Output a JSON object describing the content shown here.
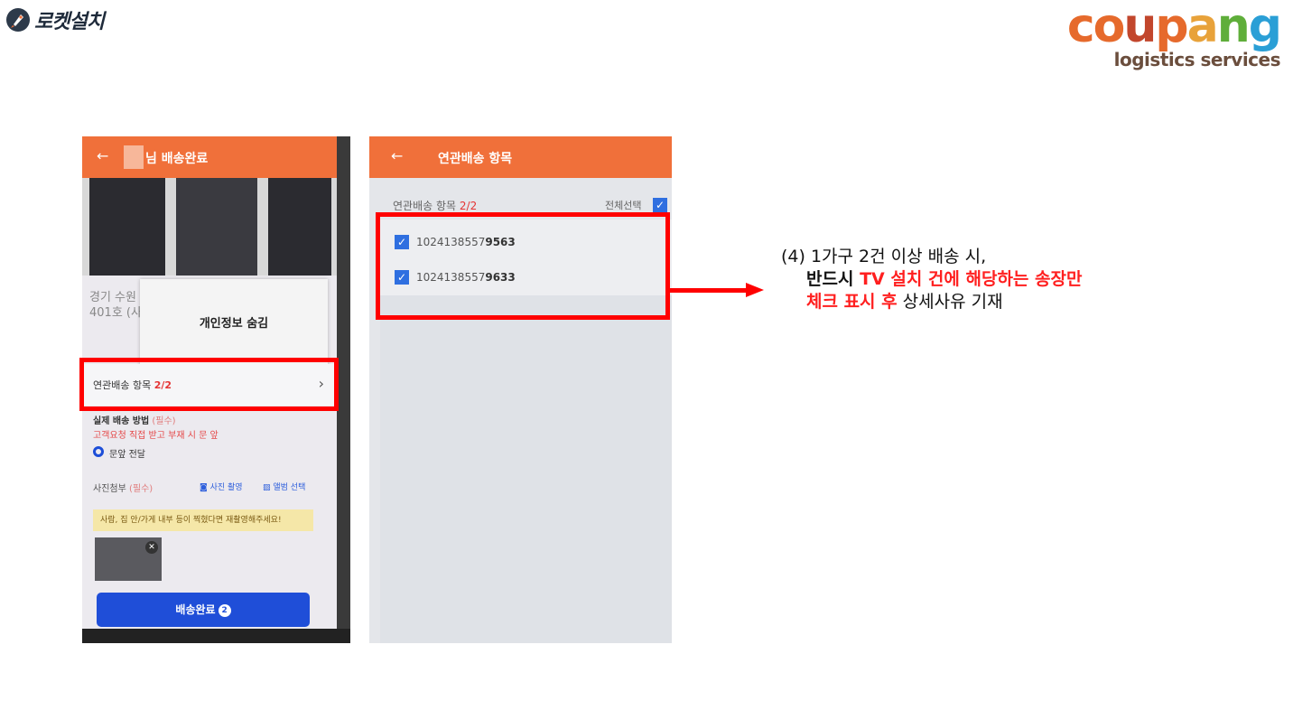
{
  "brand": {
    "name": "로켓설치",
    "icon": "rocket-icon"
  },
  "logo": {
    "word_parts": [
      {
        "text": "c",
        "color": "#e66a2c"
      },
      {
        "text": "o",
        "color": "#e66a2c"
      },
      {
        "text": "u",
        "color": "#c2462c"
      },
      {
        "text": "p",
        "color": "#e66a2c"
      },
      {
        "text": "a",
        "color": "#e8a23a"
      },
      {
        "text": "n",
        "color": "#5fae3a"
      },
      {
        "text": "g",
        "color": "#2a9fd6"
      }
    ],
    "subtitle": "logistics services"
  },
  "phone1": {
    "header_title": "님 배송완료",
    "address": [
      "경기 수원",
      "401호 (사"
    ],
    "modal_title": "개인정보 숨김",
    "related_label": "연관배송 항목",
    "related_count": "2/2",
    "method_label": "실제 배송 방법",
    "required_tag": "(필수)",
    "method_note": "고객요청 직접 받고 부재 시 문 앞",
    "method_option": "문앞 전달",
    "photo_label": "사진첨부",
    "photo_required": "(필수)",
    "camera_label": "사진 촬영",
    "album_label": "앨범 선택",
    "notice_text": "사람, 집 안/가게 내부 등이 찍혔다면 재촬영해주세요!",
    "complete_button": "배송완료",
    "complete_badge": "2"
  },
  "phone2": {
    "header_title": "연관배송 항목",
    "count_label": "연관배송 항목",
    "count_value": "2/2",
    "select_all": "전체선택",
    "items": [
      {
        "prefix": "1024138557",
        "suffix": "9563",
        "checked": true
      },
      {
        "prefix": "1024138557",
        "suffix": "9633",
        "checked": true
      }
    ]
  },
  "note": {
    "line1": "(4) 1가구 2건 이상 배송 시,",
    "line2_bold": "반드시 ",
    "line2_red": "TV 설치 건에 해당하는 송장만",
    "line3_red": "체크 표시 후",
    "line3_rest": " 상세사유 기재"
  },
  "colors": {
    "accent_orange": "#f0703a",
    "highlight_red": "#ff0000",
    "primary_blue": "#1f4ed8"
  }
}
